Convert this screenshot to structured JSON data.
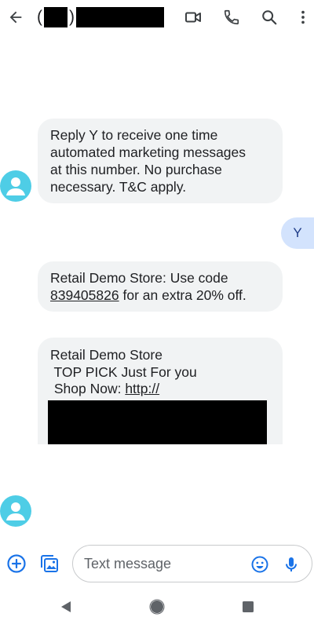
{
  "header": {
    "open_paren": "(",
    "close_paren": ")",
    "back_icon": "arrow-back-icon",
    "actions": [
      "video-call-icon",
      "phone-icon",
      "search-icon",
      "more-vert-icon"
    ]
  },
  "messages": [
    {
      "direction": "incoming",
      "lines": [
        "Reply Y to receive one time",
        "automated marketing messages",
        "at this number. No purchase",
        "necessary. T&C apply."
      ]
    },
    {
      "direction": "outgoing",
      "text": "Y"
    },
    {
      "direction": "incoming",
      "line1": "Retail Demo Store: Use code",
      "code": "839405826",
      "line2_rest": " for an extra 20% off."
    },
    {
      "direction": "incoming",
      "line1": "Retail Demo Store",
      "line2": " TOP PICK Just For you",
      "line3_prefix": " Shop Now: ",
      "link": "http://"
    }
  ],
  "compose": {
    "placeholder": "Text message",
    "icons": [
      "add-circle-icon",
      "gallery-icon",
      "emoji-icon",
      "mic-icon"
    ]
  },
  "nav": {
    "icons": [
      "back-triangle-icon",
      "home-circle-icon",
      "recents-square-icon"
    ]
  },
  "colors": {
    "accent": "#1a73e8",
    "avatar": "#4ecde6",
    "incoming_bubble": "#f1f3f4",
    "outgoing_bubble": "#d3e3fd"
  }
}
